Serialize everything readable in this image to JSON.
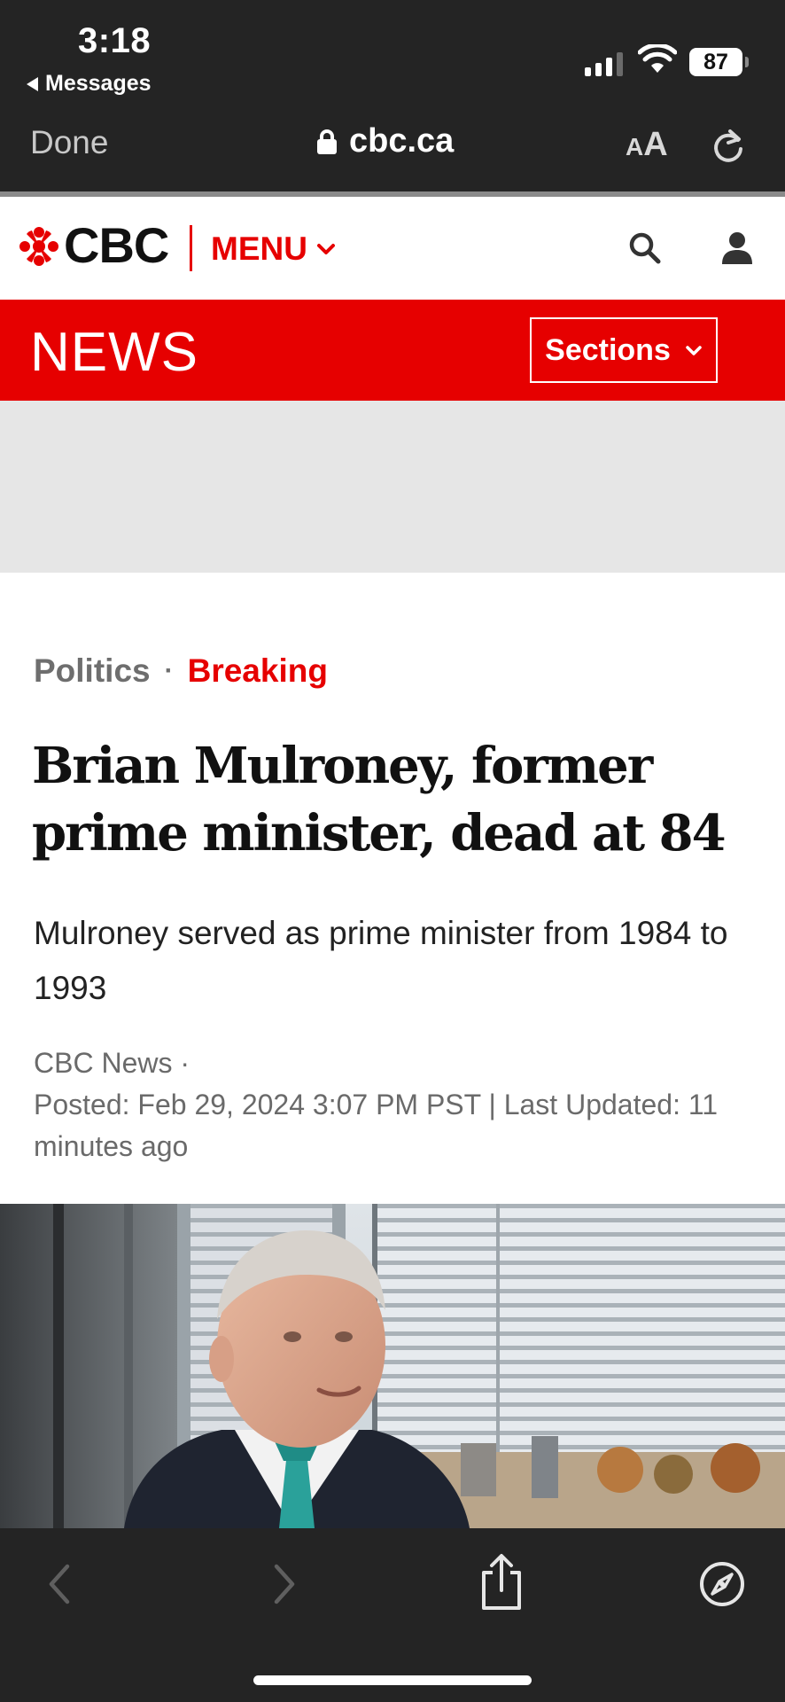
{
  "status_bar": {
    "time": "3:18",
    "back_app": "Messages",
    "battery": "87"
  },
  "browser": {
    "done_label": "Done",
    "url": "cbc.ca",
    "text_size_small": "A",
    "text_size_large": "A"
  },
  "site": {
    "logo_text": "CBC",
    "menu_label": "MENU",
    "section_name": "NEWS",
    "sections_label": "Sections",
    "brand_color": "#e60000"
  },
  "article": {
    "category": "Politics",
    "separator": "·",
    "tag": "Breaking",
    "headline": "Brian Mulroney, former prime minister, dead at 84",
    "deck": "Mulroney served as prime minister from 1984 to 1993",
    "source": "CBC News ·",
    "posted": "Posted: Feb 29, 2024 3:07 PM PST | Last Updated: 11 minutes ago"
  },
  "icons": {
    "status": [
      "signal-icon",
      "wifi-icon",
      "battery-icon"
    ],
    "header": [
      "cbc-gem-icon",
      "chevron-down-icon",
      "search-icon",
      "user-icon"
    ],
    "toolbar": [
      "back-arrow-icon",
      "forward-arrow-icon",
      "share-icon",
      "compass-icon"
    ]
  }
}
